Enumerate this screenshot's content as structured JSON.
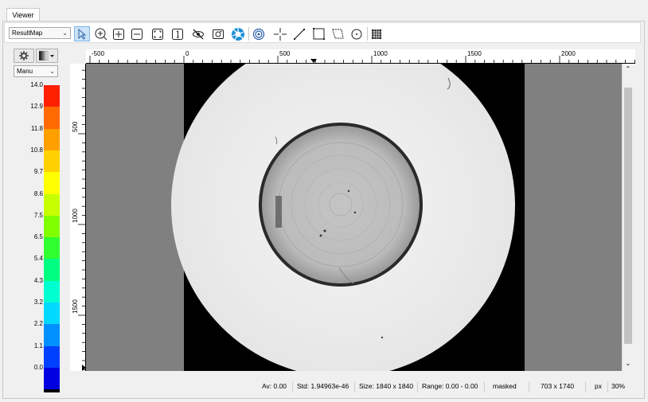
{
  "tab": {
    "label": "Viewer"
  },
  "toolbar": {
    "result_select": "ResultMap",
    "icons": [
      "pointer-icon",
      "zoom-in-icon",
      "expand-icon",
      "collapse-icon",
      "fit-icon",
      "one-to-one-icon",
      "hide-icon",
      "snapshot-icon",
      "aperture-icon",
      "profile-icon",
      "crosshair-icon",
      "line-icon",
      "rectangle-icon",
      "polygon-icon",
      "circle-icon",
      "grid-icon"
    ]
  },
  "colormap": {
    "mode_select": "Manu",
    "labels": [
      "14.0",
      "12.9",
      "11.8",
      "10.8",
      "9.7",
      "8.6",
      "7.5",
      "6.5",
      "5.4",
      "4.3",
      "3.2",
      "2.2",
      "1.1",
      "0.0"
    ],
    "colors": [
      "#ff2000",
      "#ff6a00",
      "#ffa000",
      "#ffd000",
      "#ffff00",
      "#c8ff00",
      "#80ff00",
      "#30ff30",
      "#00ff80",
      "#00ffd0",
      "#00d8ff",
      "#0090ff",
      "#0040ff",
      "#0000e0"
    ]
  },
  "ruler": {
    "x_labels": [
      "-500",
      "0",
      "500",
      "1000",
      "1500",
      "2000"
    ],
    "y_labels": [
      "500",
      "1000",
      "1500"
    ]
  },
  "status": {
    "av": "Av: 0.00",
    "std": "Std: 1.94963e-46",
    "size": "Size: 1840 x 1840",
    "range": "Range: 0.00 - 0.00",
    "masked": "masked",
    "cursor": "703 x 1740",
    "unit": "px",
    "zoom": "30%"
  }
}
